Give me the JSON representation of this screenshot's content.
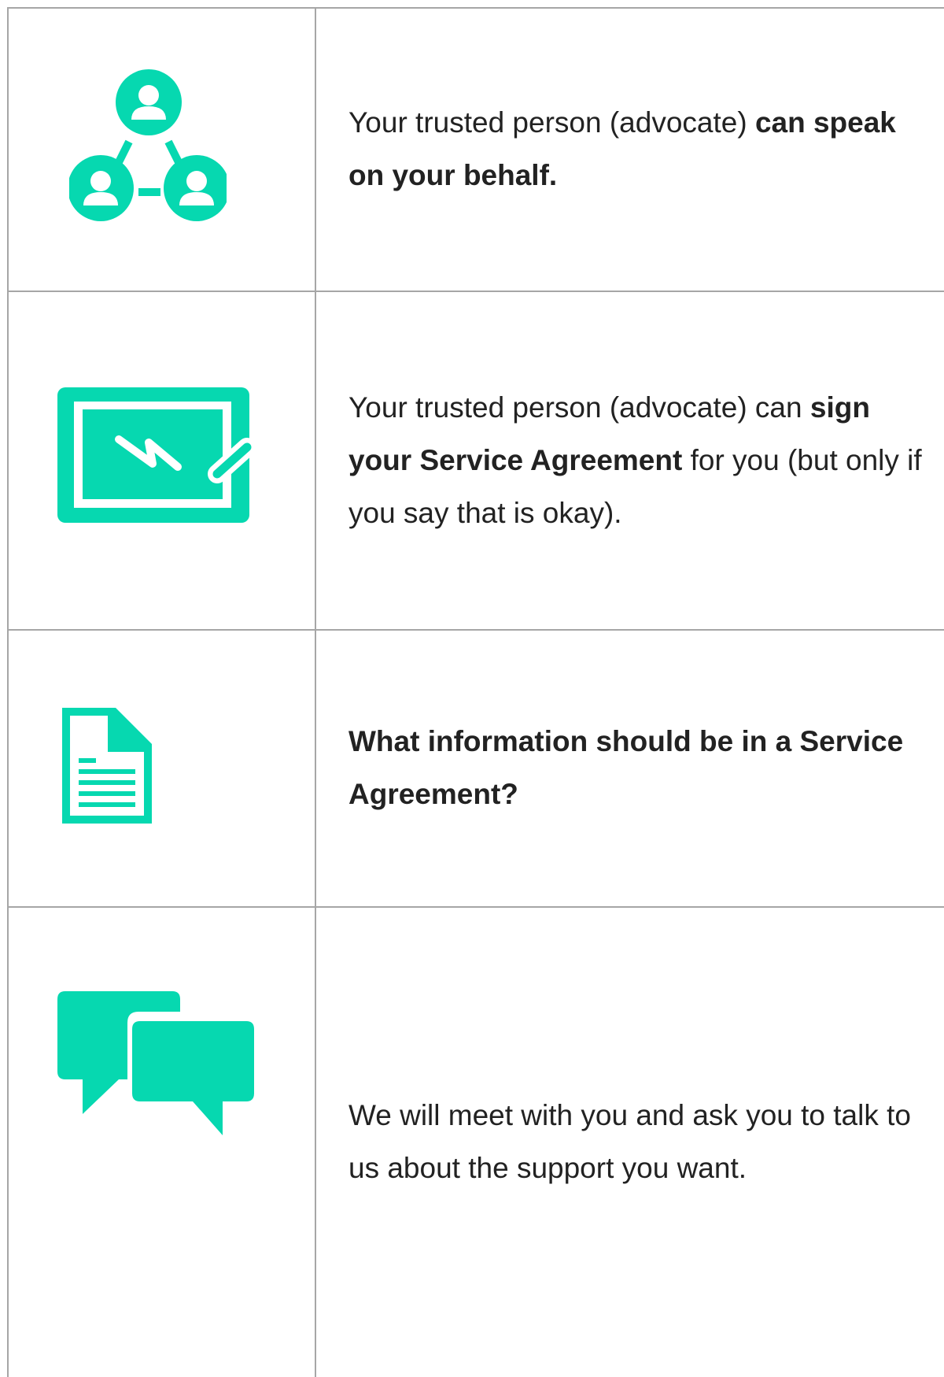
{
  "theme": {
    "accent": "#06d8b0",
    "border": "#a6a6a6",
    "text": "#222222"
  },
  "rows": [
    {
      "icon": "people-network-icon",
      "segments": [
        {
          "text": "Your trusted person (advocate) ",
          "bold": false
        },
        {
          "text": "can speak on your behalf.",
          "bold": true
        }
      ]
    },
    {
      "icon": "signature-board-icon",
      "segments": [
        {
          "text": "Your trusted person (advocate) can ",
          "bold": false
        },
        {
          "text": "sign your Service Agreement",
          "bold": true
        },
        {
          "text": " for you (but only if you say that is okay).",
          "bold": false
        }
      ]
    },
    {
      "icon": "document-icon",
      "segments": [
        {
          "text": "What information should be in a Service Agreement?",
          "bold": true
        }
      ]
    },
    {
      "icon": "speech-bubbles-icon",
      "segments": [
        {
          "text": "We will meet with you and ask you to talk to us about the support you want.",
          "bold": false
        }
      ]
    }
  ]
}
